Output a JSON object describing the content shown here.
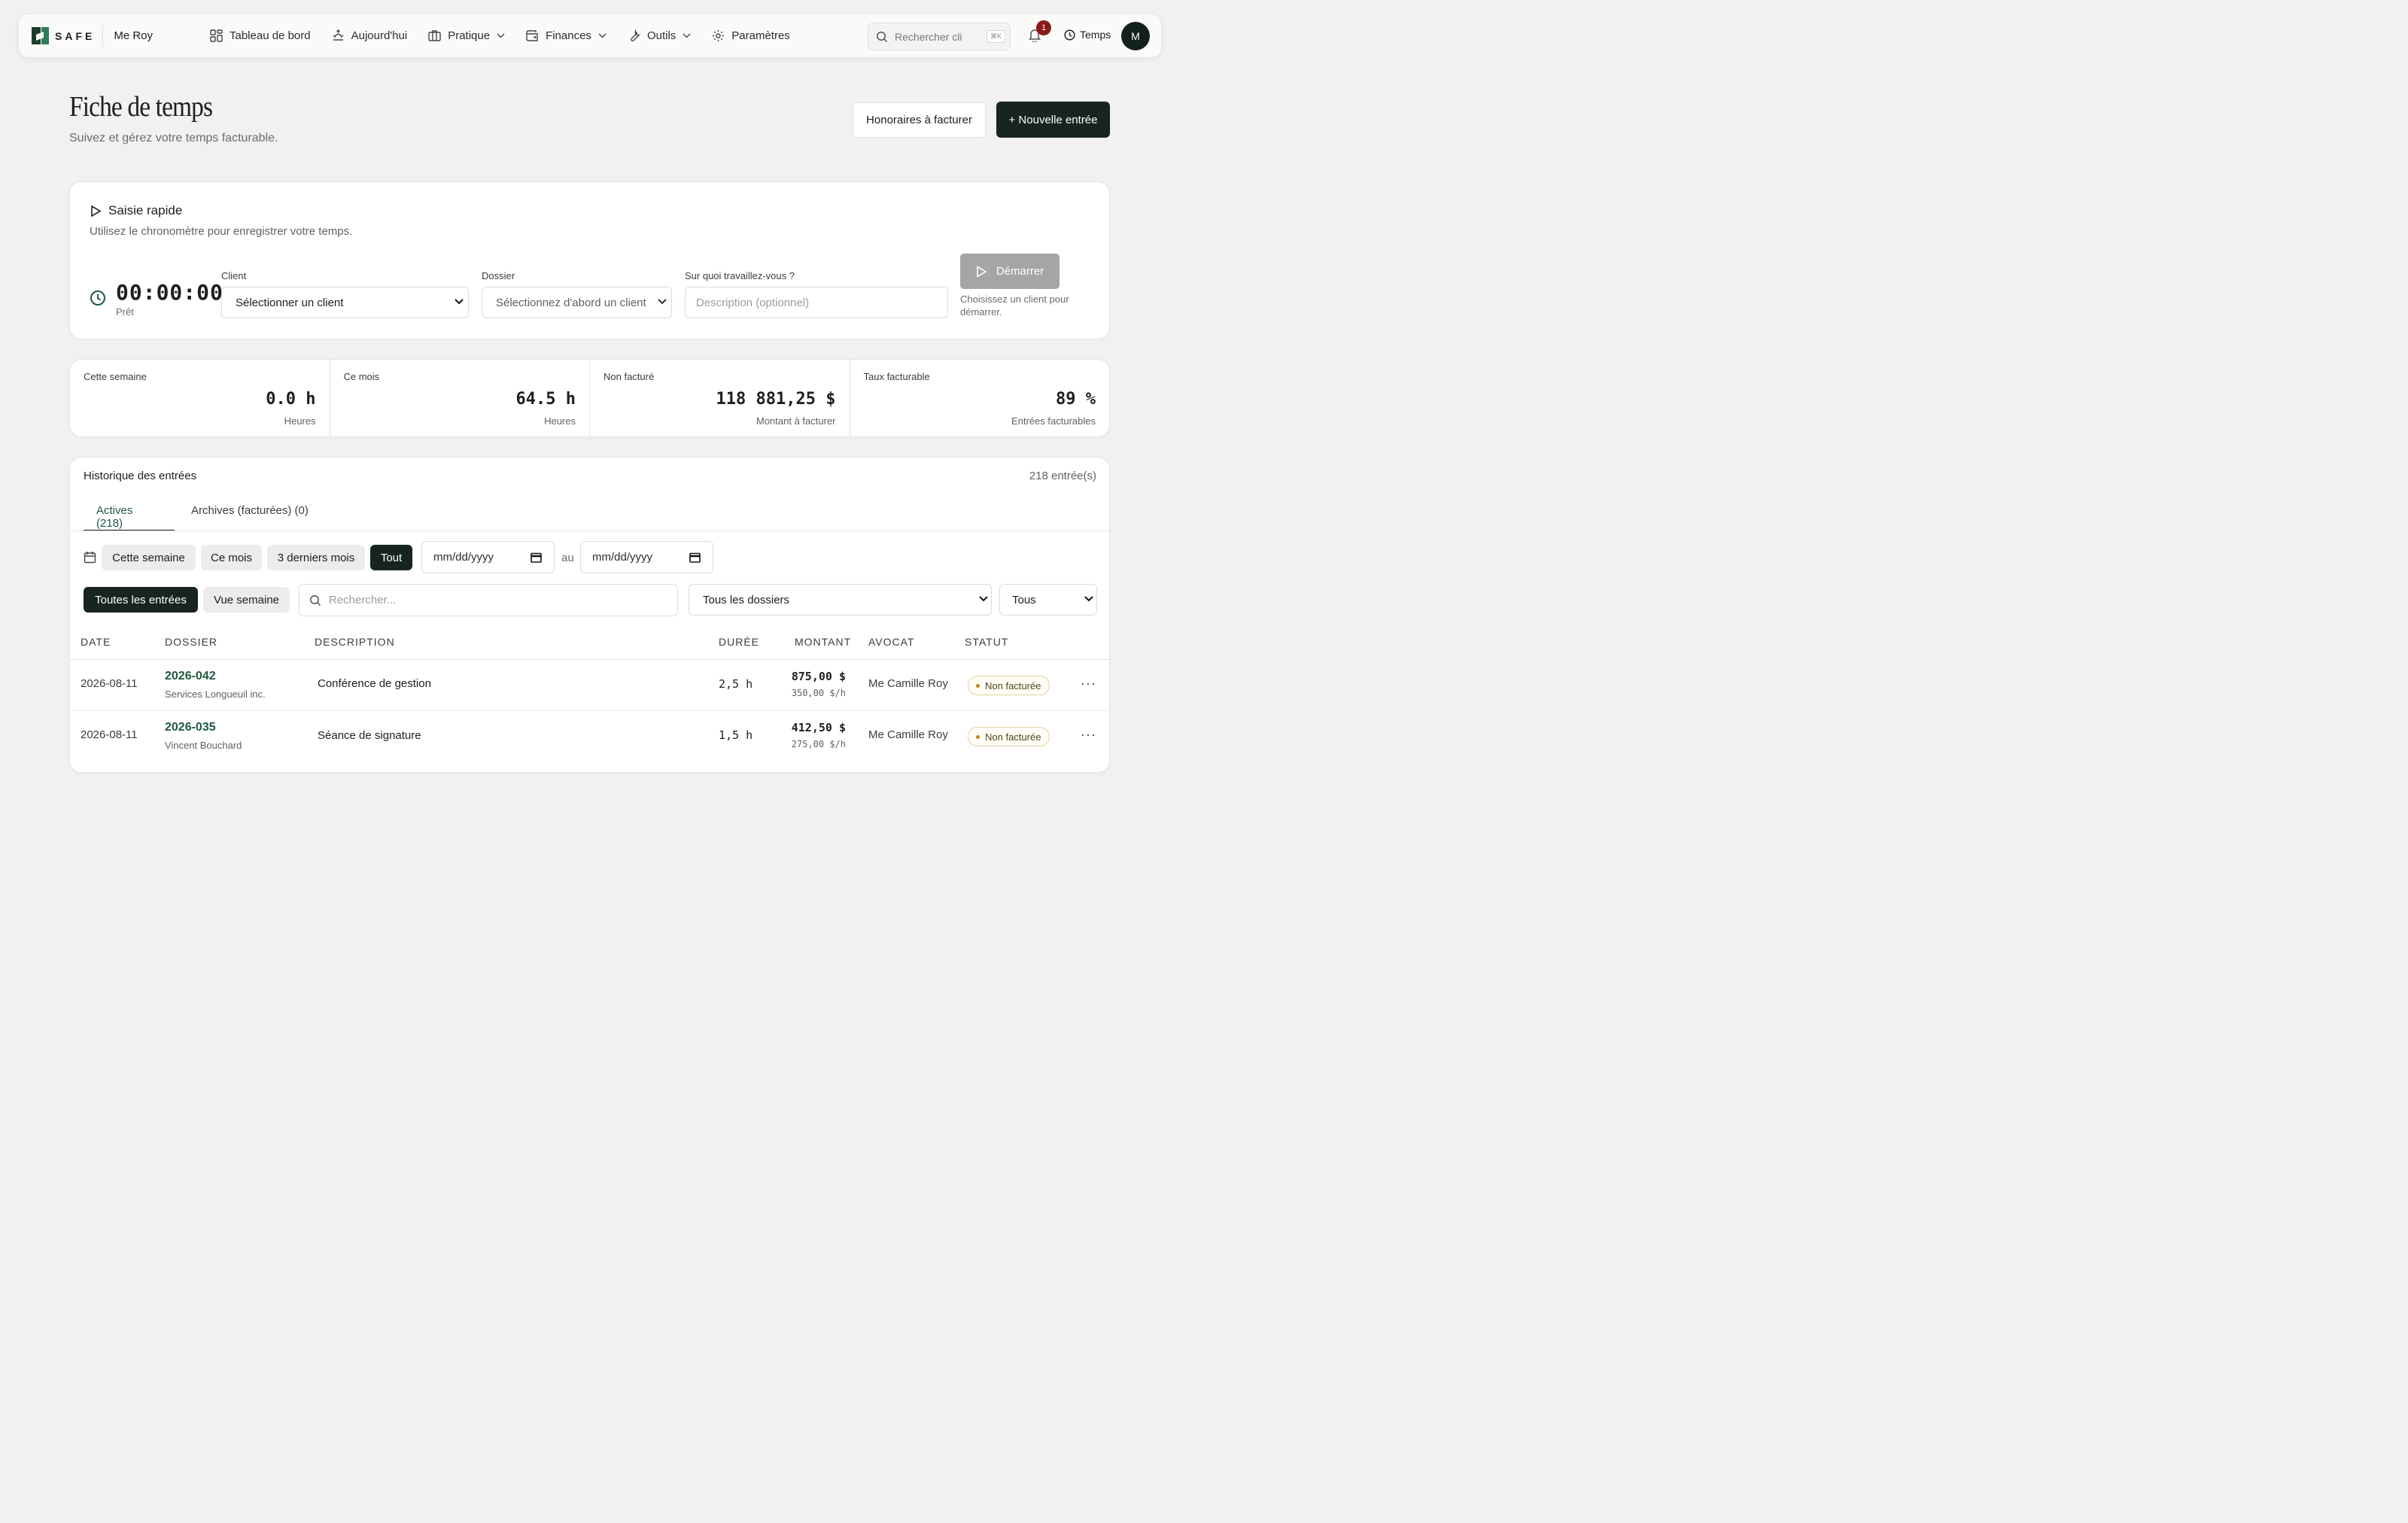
{
  "nav": {
    "logo_text": "SAFE",
    "user_name": "Me Roy",
    "items": [
      {
        "label": "Tableau de bord",
        "icon": "grid-icon",
        "has_dropdown": false
      },
      {
        "label": "Aujourd'hui",
        "icon": "sunrise-icon",
        "has_dropdown": false
      },
      {
        "label": "Pratique",
        "icon": "briefcase-icon",
        "has_dropdown": true
      },
      {
        "label": "Finances",
        "icon": "wallet-icon",
        "has_dropdown": true
      },
      {
        "label": "Outils",
        "icon": "wrench-icon",
        "has_dropdown": true
      },
      {
        "label": "Paramètres",
        "icon": "gear-icon",
        "has_dropdown": false
      }
    ],
    "search_placeholder": "Rechercher cli",
    "search_shortcut": "⌘K",
    "notification_count": "1",
    "temps_label": "Temps",
    "avatar_initial": "M"
  },
  "header": {
    "title": "Fiche de temps",
    "subtitle": "Suivez et gérez votre temps facturable.",
    "btn_honoraires": "Honoraires à facturer",
    "btn_new_entry": "+ Nouvelle entrée"
  },
  "quick_entry": {
    "title": "Saisie rapide",
    "subtitle": "Utilisez le chronomètre pour enregistrer votre temps.",
    "timer": "00:00:00",
    "timer_status": "Prêt",
    "client_label": "Client",
    "client_value": "Sélectionner un client",
    "dossier_label": "Dossier",
    "dossier_value": "Sélectionnez d'abord un client",
    "description_label": "Sur quoi travaillez-vous ?",
    "description_placeholder": "Description (optionnel)",
    "start_label": "Démarrer",
    "start_hint": "Choisissez un client pour démarrer."
  },
  "stats": [
    {
      "label": "Cette semaine",
      "value": "0.0 h",
      "sub": "Heures"
    },
    {
      "label": "Ce mois",
      "value": "64.5 h",
      "sub": "Heures"
    },
    {
      "label": "Non facturé",
      "value": "118 881,25 $",
      "sub": "Montant à facturer"
    },
    {
      "label": "Taux facturable",
      "value": "89 %",
      "sub": "Entrées facturables"
    }
  ],
  "history": {
    "title": "Historique des entrées",
    "count": "218 entrée(s)",
    "tabs": [
      "Actives (218)",
      "Archives (facturées) (0)"
    ],
    "period_chips": [
      "Cette semaine",
      "Ce mois",
      "3 derniers mois",
      "Tout"
    ],
    "date_placeholder": "mm/dd/yyyy",
    "date_sep": "au",
    "view_chips": [
      "Toutes les entrées",
      "Vue semaine"
    ],
    "search_placeholder": "Rechercher...",
    "dossier_filter": "Tous les dossiers",
    "status_filter": "Tous",
    "columns": [
      "DATE",
      "DOSSIER",
      "DESCRIPTION",
      "DURÉE",
      "MONTANT",
      "AVOCAT",
      "STATUT"
    ],
    "rows": [
      {
        "date": "2026-08-11",
        "dossier": "2026-042",
        "client": "Services Longueuil inc.",
        "description": "Conférence de gestion",
        "duree": "2,5 h",
        "montant": "875,00 $",
        "taux": "350,00 $/h",
        "avocat": "Me Camille Roy",
        "statut": "Non facturée"
      },
      {
        "date": "2026-08-11",
        "dossier": "2026-035",
        "client": "Vincent Bouchard",
        "description": "Séance de signature",
        "duree": "1,5 h",
        "montant": "412,50 $",
        "taux": "275,00 $/h",
        "avocat": "Me Camille Roy",
        "statut": "Non facturée"
      }
    ]
  }
}
